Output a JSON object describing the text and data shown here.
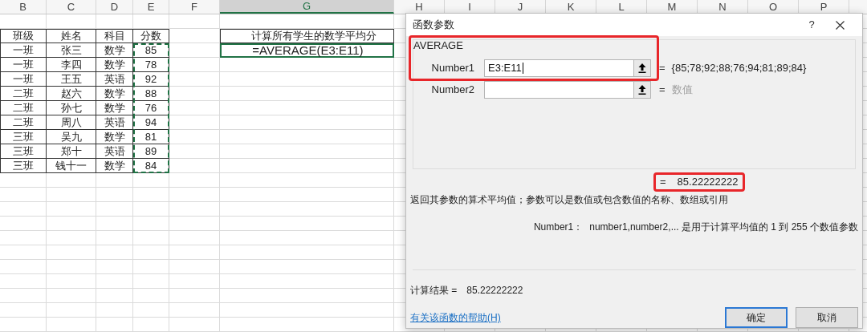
{
  "sheet": {
    "columns": [
      {
        "label": "B",
        "selected": false
      },
      {
        "label": "C",
        "selected": false
      },
      {
        "label": "D",
        "selected": false
      },
      {
        "label": "E",
        "selected": false
      },
      {
        "label": "F",
        "selected": false
      },
      {
        "label": "G",
        "selected": true
      },
      {
        "label": "H",
        "selected": false
      },
      {
        "label": "I",
        "selected": false
      },
      {
        "label": "J",
        "selected": false
      },
      {
        "label": "K",
        "selected": false
      },
      {
        "label": "L",
        "selected": false
      },
      {
        "label": "M",
        "selected": false
      },
      {
        "label": "N",
        "selected": false
      },
      {
        "label": "O",
        "selected": false
      },
      {
        "label": "P",
        "selected": false
      }
    ],
    "table": {
      "header": [
        "班级",
        "姓名",
        "科目",
        "分数"
      ],
      "rows": [
        {
          "cells": [
            "一班",
            "张三",
            "数学",
            "85"
          ]
        },
        {
          "cells": [
            "一班",
            "李四",
            "数学",
            "78"
          ]
        },
        {
          "cells": [
            "一班",
            "王五",
            "英语",
            "92"
          ]
        },
        {
          "cells": [
            "二班",
            "赵六",
            "数学",
            "88"
          ]
        },
        {
          "cells": [
            "二班",
            "孙七",
            "数学",
            "76"
          ]
        },
        {
          "cells": [
            "二班",
            "周八",
            "英语",
            "94"
          ]
        },
        {
          "cells": [
            "三班",
            "吴九",
            "数学",
            "81"
          ]
        },
        {
          "cells": [
            "三班",
            "郑十",
            "英语",
            "89"
          ]
        },
        {
          "cells": [
            "三班",
            "钱十一",
            "数学",
            "84"
          ]
        }
      ],
      "score_range_marked": true
    },
    "note": "计算所有学生的数学平均分",
    "formula_cell": {
      "value": "=AVERAGE(E3:E11)",
      "selected": true
    }
  },
  "dialog": {
    "title": "函数参数",
    "help": "?",
    "function_name": "AVERAGE",
    "args": [
      {
        "label": "Number1",
        "value": "E3:E11",
        "equals": "=",
        "result": "{85;78;92;88;76;94;81;89;84}",
        "kind": "value",
        "highlighted": true
      },
      {
        "label": "Number2",
        "equals": "=",
        "result": "数值",
        "kind": "hint",
        "highlighted": false
      }
    ],
    "formula_result": {
      "equals": "=",
      "value": "85.22222222",
      "highlighted": true
    },
    "description": "返回其参数的算术平均值；参数可以是数值或包含数值的名称、数组或引用",
    "arg_help": {
      "label": "Number1：",
      "text": "number1,number2,... 是用于计算平均值的 1 到 255 个数值参数"
    },
    "calc_result": {
      "label": "计算结果 =",
      "value": "85.22222222"
    },
    "help_link": "有关该函数的帮助(H)",
    "buttons": [
      {
        "label": "确定",
        "default": true
      },
      {
        "label": "取消",
        "default": false
      }
    ]
  }
}
